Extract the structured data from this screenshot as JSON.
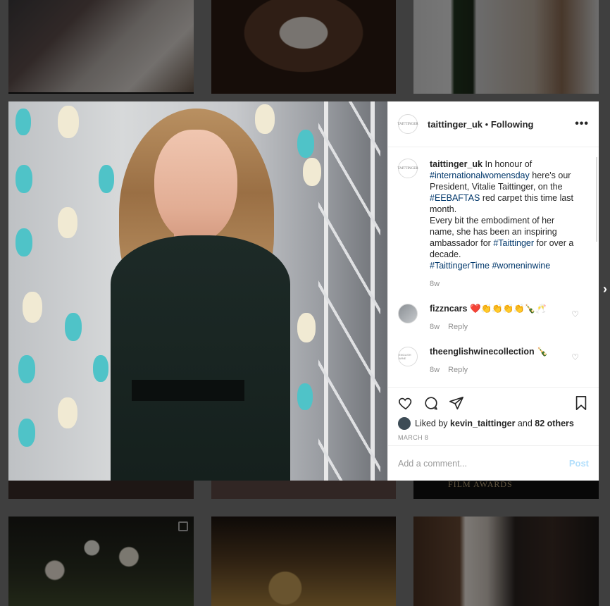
{
  "background": {
    "film_awards_text": "FILM AWARDS"
  },
  "post": {
    "header": {
      "username": "taittinger_uk",
      "separator": "•",
      "follow_status": "Following",
      "more_glyph": "•••"
    },
    "caption": {
      "username": "taittinger_uk",
      "text_1": "In honour of",
      "hashtag_1": "#internationalwomensday",
      "text_2": "here's our President, Vitalie Taittinger, on the",
      "hashtag_2": "#EEBAFTAS",
      "text_3": "red carpet this time last month.",
      "text_4": "Every bit the embodiment of her name, she has been an inspiring ambassador for",
      "hashtag_3": "#Taittinger",
      "text_5": "for over a decade.",
      "hashtag_4": "#TaittingerTime",
      "hashtag_5": "#womeninwine",
      "time": "8w"
    },
    "comments": [
      {
        "username": "fizzncars",
        "text": "❤️👏👏👏👏🍾🥂",
        "time": "8w",
        "reply": "Reply"
      },
      {
        "username": "theenglishwinecollection",
        "text": "🍾",
        "time": "8w",
        "reply": "Reply"
      }
    ],
    "likes": {
      "prefix": "Liked by",
      "user": "kevin_taittinger",
      "and": "and",
      "others": "82 others"
    },
    "date": "MARCH 8",
    "add_comment": {
      "placeholder": "Add a comment...",
      "post_label": "Post"
    }
  },
  "colors": {
    "hashtag": "#00376b",
    "post_button_disabled": "#b2dffc",
    "muted_text": "#8e8e8e"
  }
}
